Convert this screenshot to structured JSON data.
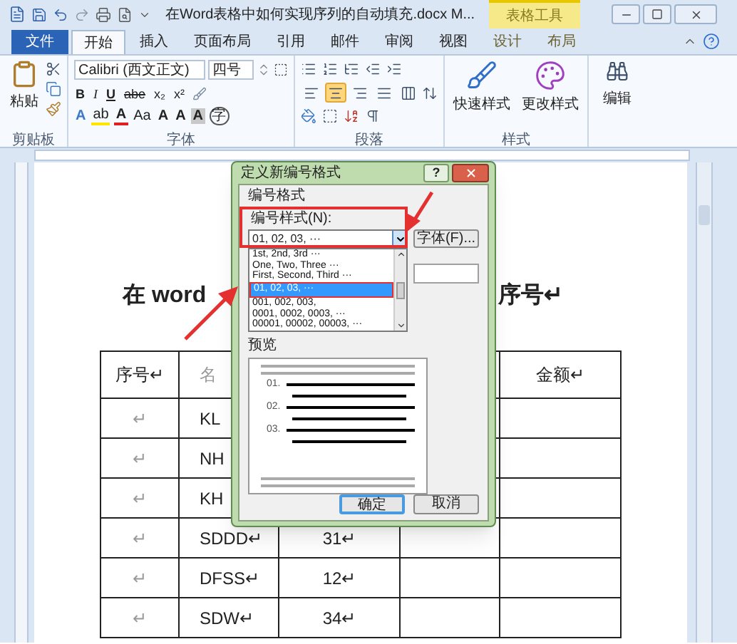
{
  "window": {
    "title": "在Word表格中如何实现序列的自动填充.docx M...",
    "context_label": "表格工具"
  },
  "tabs": [
    {
      "label": "文件",
      "kind": "file",
      "selected": false
    },
    {
      "label": "开始",
      "kind": "tab",
      "selected": true
    },
    {
      "label": "插入",
      "kind": "tab",
      "selected": false
    },
    {
      "label": "页面布局",
      "kind": "tab",
      "selected": false
    },
    {
      "label": "引用",
      "kind": "tab",
      "selected": false
    },
    {
      "label": "邮件",
      "kind": "tab",
      "selected": false
    },
    {
      "label": "审阅",
      "kind": "tab",
      "selected": false
    },
    {
      "label": "视图",
      "kind": "tab",
      "selected": false
    },
    {
      "label": "设计",
      "kind": "context",
      "selected": false
    },
    {
      "label": "布局",
      "kind": "context",
      "selected": false
    }
  ],
  "ribbon": {
    "clipboard": {
      "label": "剪贴板",
      "paste": "粘贴"
    },
    "font": {
      "label": "字体",
      "font_name": "Calibri (西文正文)",
      "font_size": "四号",
      "row2": [
        {
          "kind": "bold",
          "text": "B"
        },
        {
          "kind": "italic",
          "text": "I"
        },
        {
          "kind": "underline",
          "text": "U"
        },
        {
          "kind": "strike",
          "text": "abe"
        },
        {
          "kind": "sub",
          "text": "x₂"
        },
        {
          "kind": "sup",
          "text": "x²"
        }
      ],
      "row3": [
        {
          "kind": "effect",
          "text": "A"
        },
        {
          "kind": "highlight",
          "text": "ab"
        },
        {
          "kind": "color",
          "text": "A"
        },
        {
          "kind": "case",
          "text": "Aa"
        },
        {
          "kind": "grow",
          "text": "A"
        },
        {
          "kind": "shrink",
          "text": "A"
        },
        {
          "kind": "shade",
          "text": "A"
        },
        {
          "kind": "enclose",
          "text": "字"
        }
      ]
    },
    "paragraph": {
      "label": "段落",
      "align": [
        {
          "kind": "left",
          "selected": false
        },
        {
          "kind": "center",
          "selected": true
        },
        {
          "kind": "right",
          "selected": false
        },
        {
          "kind": "justify",
          "selected": false
        },
        {
          "kind": "distribute",
          "selected": false
        }
      ]
    },
    "styles": {
      "label": "样式",
      "quick": "快速样式",
      "change": "更改样式"
    },
    "editing": {
      "label": "编辑"
    }
  },
  "document": {
    "title_start": "在 word",
    "title_end": "序号↵",
    "table": {
      "header": {
        "column_1": "序号↵",
        "column_2": "名",
        "column_5": "金额↵"
      },
      "rows": [
        {
          "column_1": "↵",
          "column_2": "KL"
        },
        {
          "column_1": "↵",
          "column_2": "NH"
        },
        {
          "column_1": "↵",
          "column_2": "KH"
        },
        {
          "column_1": "↵",
          "column_2": "SDDD↵",
          "column_3": "31↵"
        },
        {
          "column_1": "↵",
          "column_2": "DFSS↵",
          "column_3": "12↵"
        },
        {
          "column_1": "↵",
          "column_2": "SDW↵",
          "column_3": "34↵"
        }
      ]
    }
  },
  "dialog": {
    "title": "定义新编号格式",
    "help_button": "?",
    "group_label": "编号格式",
    "style_label": "编号样式(N):",
    "style_value": "01, 02, 03, ···",
    "font_button": "字体(F)...",
    "options": [
      {
        "label": "1st, 2nd, 3rd ···",
        "selected": false
      },
      {
        "label": "One, Two, Three ···",
        "selected": false
      },
      {
        "label": "First, Second, Third ···",
        "selected": false
      },
      {
        "label": "01, 02, 03, ···",
        "selected": true
      },
      {
        "label": "001, 002, 003,",
        "selected": false
      },
      {
        "label": "0001, 0002, 0003, ···",
        "selected": false
      },
      {
        "label": "00001, 00002, 00003, ···",
        "selected": false
      }
    ],
    "preview_label": "预览",
    "preview_numbers": [
      "01.",
      "02.",
      "03."
    ],
    "buttons": [
      {
        "label": "确定",
        "default": true
      },
      {
        "label": "取消",
        "default": false
      }
    ]
  }
}
